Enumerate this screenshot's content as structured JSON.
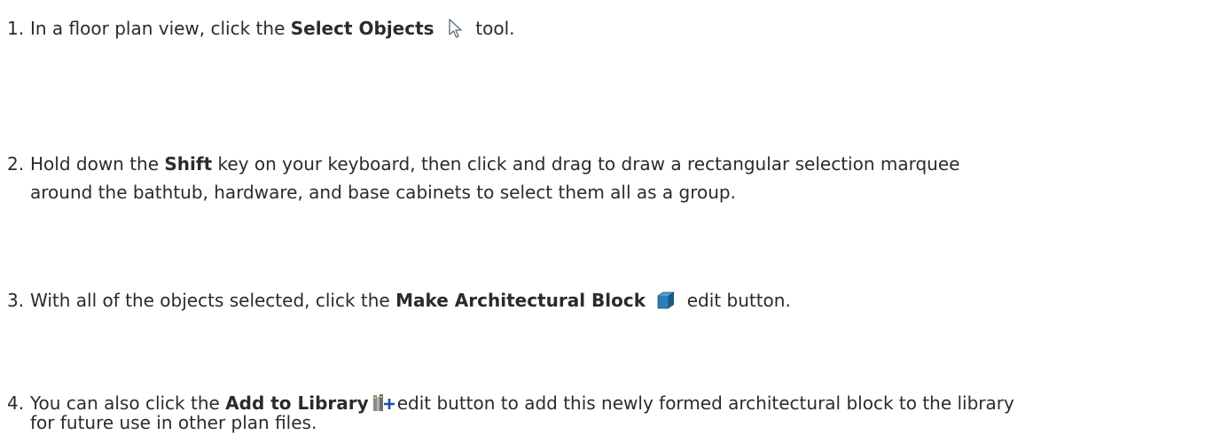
{
  "steps": [
    {
      "number": "1.",
      "prefix": "In a floor plan view, click the ",
      "bold": "Select Objects",
      "icon": "select-objects-arrow-icon",
      "suffix": "tool."
    },
    {
      "number": "2.",
      "prefix": "Hold down the ",
      "bold": "Shift",
      "suffix_line1": " key on your keyboard, then click and drag to draw a rectangular selection marquee",
      "line2": "around the bathtub, hardware, and base cabinets to select them all as a group."
    },
    {
      "number": "3.",
      "prefix": "With all of the objects selected, click the ",
      "bold": "Make Architectural Block",
      "icon": "make-architectural-block-icon",
      "suffix": "edit button."
    },
    {
      "number": "4.",
      "prefix": "You can also click the ",
      "bold": "Add to Library",
      "icon": "add-to-library-icon",
      "suffix_line1": "edit button to add this newly formed architectural block to the library",
      "line2": "for future use in other plan files."
    }
  ],
  "colors": {
    "text": "#2b2b2b",
    "block_icon": "#2e7fb8",
    "library_icon_plus": "#1f4fa8"
  }
}
